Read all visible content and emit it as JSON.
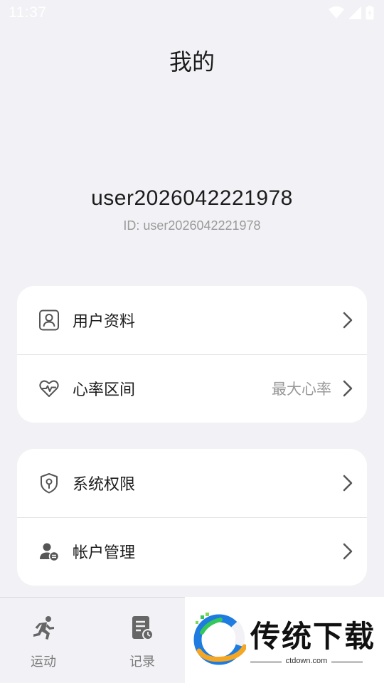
{
  "status_bar": {
    "time": "11:37"
  },
  "header": {
    "title": "我的"
  },
  "profile": {
    "username": "user2026042221978",
    "id_text": "ID: user2026042221978"
  },
  "menu_group_1": [
    {
      "label": "用户资料",
      "icon": "user-profile-icon"
    },
    {
      "label": "心率区间",
      "value": "最大心率",
      "icon": "heart-rate-icon"
    }
  ],
  "menu_group_2": [
    {
      "label": "系统权限",
      "icon": "shield-icon"
    },
    {
      "label": "帐户管理",
      "icon": "account-icon"
    }
  ],
  "tab_bar": {
    "tabs": [
      {
        "label": "运动",
        "icon": "running-icon"
      },
      {
        "label": "记录",
        "icon": "record-icon"
      }
    ]
  },
  "watermark": {
    "text": "传统下载",
    "url": "ctdown.com"
  }
}
